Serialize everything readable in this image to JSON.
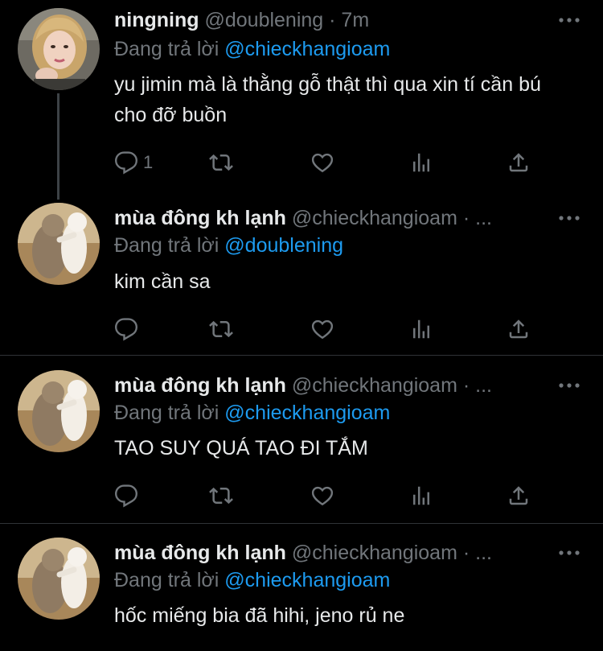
{
  "theme": {
    "background": "#000000",
    "text": "#e7e9ea",
    "muted": "#71767b",
    "link": "#1d9bf0",
    "divider": "#2f3336"
  },
  "tweets": [
    {
      "name": "ningning",
      "handle": "@doublening",
      "time": "· 7m",
      "reply_prefix": "Đang trả lời",
      "reply_to": "@chieckhangioam",
      "text": "yu jimin mà là thằng gỗ thật thì qua xin tí cần bú cho đỡ buồn",
      "reply_count": "1",
      "avatar": "girl-avatar"
    },
    {
      "name": "mùa đông kh lạnh",
      "handle": "@chieckhangioam",
      "time": "· ...",
      "reply_prefix": "Đang trả lời",
      "reply_to": "@doublening",
      "text": "kim cần sa",
      "reply_count": "",
      "avatar": "cats-avatar"
    },
    {
      "name": "mùa đông kh lạnh",
      "handle": "@chieckhangioam",
      "time": "· ...",
      "reply_prefix": "Đang trả lời",
      "reply_to": "@chieckhangioam",
      "text": "TAO SUY QUÁ TAO ĐI TẮM",
      "reply_count": "",
      "avatar": "cats-avatar"
    },
    {
      "name": "mùa đông kh lạnh",
      "handle": "@chieckhangioam",
      "time": "· ...",
      "reply_prefix": "Đang trả lời",
      "reply_to": "@chieckhangioam",
      "text": "hốc miếng bia đã hihi, jeno rủ ne",
      "reply_count": "",
      "avatar": "cats-avatar"
    }
  ]
}
